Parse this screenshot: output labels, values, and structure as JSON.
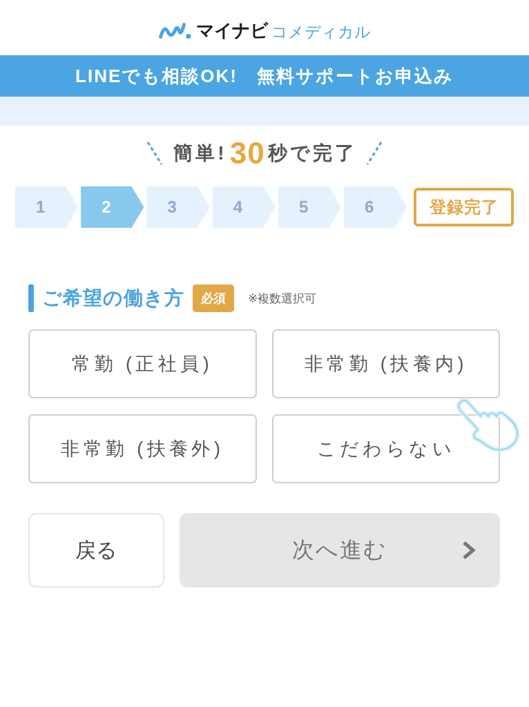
{
  "logo": {
    "brand": "マイナビ",
    "service": "コメディカル"
  },
  "banner": {
    "text": "LINEでも相談OK!　無料サポートお申込み"
  },
  "headline": {
    "prefix": "簡単!",
    "number": "30",
    "suffix": "秒で完了"
  },
  "steps": [
    {
      "label": "1",
      "kind": "number",
      "selected": false
    },
    {
      "label": "2",
      "kind": "number",
      "selected": true
    },
    {
      "label": "3",
      "kind": "number",
      "selected": false
    },
    {
      "label": "4",
      "kind": "number",
      "selected": false
    },
    {
      "label": "5",
      "kind": "number",
      "selected": false
    },
    {
      "label": "6",
      "kind": "number",
      "selected": false
    },
    {
      "label": "登録完了",
      "kind": "finish",
      "selected": false
    }
  ],
  "question": {
    "title": "ご希望の働き方",
    "badge": "必須",
    "note": "※複数選択可",
    "options": [
      {
        "label": "常勤 (正社員)",
        "selected": false
      },
      {
        "label": "非常勤 (扶養内)",
        "selected": false
      },
      {
        "label": "非常勤 (扶養外)",
        "selected": false
      },
      {
        "label": "こだわらない",
        "selected": false
      }
    ]
  },
  "buttons": [
    {
      "label": "戻る",
      "kind": "back"
    },
    {
      "label": "次へ進む",
      "kind": "next",
      "disabled": true
    }
  ]
}
